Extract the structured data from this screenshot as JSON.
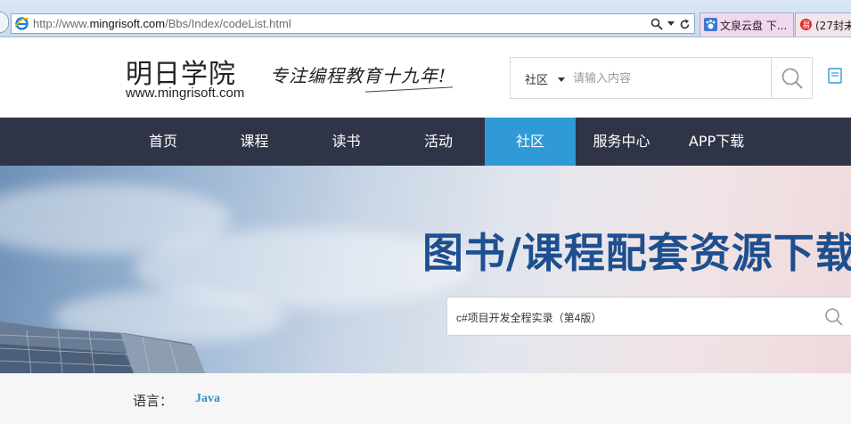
{
  "browser": {
    "url_prefix": "http://www.",
    "url_domain": "mingrisoft.com",
    "url_path": "/Bbs/Index/codeList.html",
    "tabs": [
      {
        "label": "文泉云盘 下..."
      },
      {
        "label": "(27封未"
      }
    ]
  },
  "header": {
    "logo_cn": "明日学院",
    "logo_en": "www.mingrisoft.com",
    "slogan": "专注编程教育十九年!",
    "search": {
      "category": "社区",
      "placeholder": "请输入内容"
    }
  },
  "nav": {
    "items": [
      {
        "label": "首页"
      },
      {
        "label": "课程"
      },
      {
        "label": "读书"
      },
      {
        "label": "活动"
      },
      {
        "label": "社区"
      },
      {
        "label": "服务中心"
      },
      {
        "label": "APP下载"
      }
    ],
    "active_index": 4
  },
  "banner": {
    "title": "图书/课程配套资源下载",
    "search_value": "c#项目开发全程实录（第4版）"
  },
  "filter": {
    "label": "语言：",
    "value": "Java"
  },
  "colors": {
    "nav_bg": "#2f3546",
    "nav_active": "#2f9ad6",
    "banner_title": "#1e4f8e",
    "filter_link": "#2f8fce"
  }
}
